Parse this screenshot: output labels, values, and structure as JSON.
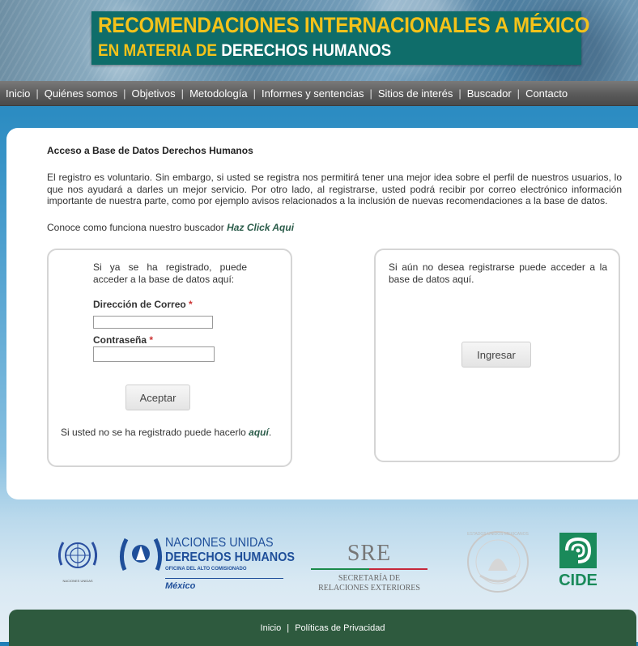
{
  "banner": {
    "title_line1": "RECOMENDACIONES INTERNACIONALES A MÉXICO",
    "title_line2_a": "EN MATERIA DE",
    "title_line2_b": "DERECHOS HUMANOS"
  },
  "nav": {
    "items": [
      "Inicio",
      "Quiénes somos",
      "Objetivos",
      "Metodología",
      "Informes y sentencias",
      "Sitios de interés",
      "Buscador",
      "Contacto"
    ],
    "separator": "|"
  },
  "main": {
    "heading": "Acceso a Base de Datos Derechos Humanos",
    "intro": "El registro es voluntario. Sin embargo, si usted se registra nos permitirá tener una mejor idea sobre el perfil de nuestros usuarios, lo que nos ayudará a darles un mejor servicio. Por otro lado, al registrarse, usted podrá recibir por correo electrónico información importante de nuestra parte, como por ejemplo avisos relacionados a la inclusión de nuevas recomendaciones a la base de datos.",
    "howto_text": "Conoce como funciona nuestro buscador ",
    "howto_link": "Haz Click Aqui"
  },
  "login": {
    "text": "Si ya se ha registrado, puede acceder a la base de datos aquí:",
    "email_label": "Dirección de Correo",
    "password_label": "Contraseña",
    "required_mark": "*",
    "email_value": "",
    "password_value": "",
    "submit_label": "Aceptar",
    "register_text": "Si usted no se ha registrado puede hacerlo ",
    "register_link": "aquí",
    "register_end": "."
  },
  "guest": {
    "text": "Si aún no desea registrarse puede acceder a la base de datos aquí.",
    "button_label": "Ingresar"
  },
  "logos": {
    "un_caption": "NACIONES UNIDAS",
    "ohchr_line1": "NACIONES UNIDAS",
    "ohchr_line2": "DERECHOS HUMANOS",
    "ohchr_line3": "OFICINA DEL ALTO COMISIONADO",
    "ohchr_line4": "México",
    "sre_abbr": "SRE",
    "sre_line1": "SECRETARÍA DE",
    "sre_line2": "RELACIONES EXTERIORES",
    "seal_caption": "ESTADOS UNIDOS MEXICANOS",
    "cide_text": "CIDE"
  },
  "footer": {
    "link1": "Inicio",
    "separator": "|",
    "link2": "Políticas de Privacidad"
  },
  "colors": {
    "title_yellow": "#f4c21a",
    "title_box": "#0f6d6a",
    "footer_green": "#2e5a3e",
    "cide_green": "#1a8a5a",
    "ohchr_blue": "#1f4f9a"
  }
}
